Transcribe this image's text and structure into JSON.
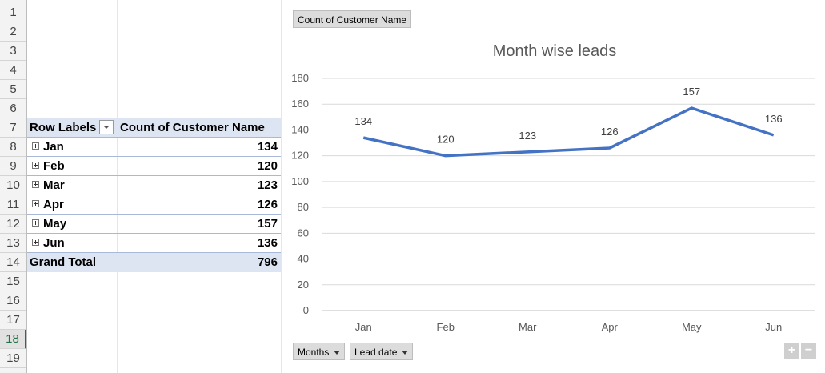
{
  "rows": [
    "1",
    "2",
    "3",
    "4",
    "5",
    "6",
    "7",
    "8",
    "9",
    "10",
    "11",
    "12",
    "13",
    "14",
    "15",
    "16",
    "17",
    "18",
    "19"
  ],
  "pivot": {
    "row_labels_header": "Row Labels",
    "value_header": "Count of Customer Name",
    "items": [
      {
        "label": "Jan",
        "value": "134"
      },
      {
        "label": "Feb",
        "value": "120"
      },
      {
        "label": "Mar",
        "value": "123"
      },
      {
        "label": "Apr",
        "value": "126"
      },
      {
        "label": "May",
        "value": "157"
      },
      {
        "label": "Jun",
        "value": "136"
      }
    ],
    "grand_total_label": "Grand Total",
    "grand_total_value": "796"
  },
  "chart_buttons": {
    "value_field": "Count of Customer Name",
    "axis_field_1": "Months",
    "axis_field_2": "Lead date",
    "zoom_in": "+",
    "zoom_out": "−"
  },
  "colors": {
    "series": "#4472c4",
    "header_fill": "#dde5f3"
  },
  "chart_data": {
    "type": "line",
    "title": "Month wise leads",
    "categories": [
      "Jan",
      "Feb",
      "Mar",
      "Apr",
      "May",
      "Jun"
    ],
    "series": [
      {
        "values": [
          134,
          120,
          123,
          126,
          157,
          136
        ]
      }
    ],
    "ylim": [
      0,
      180
    ],
    "yticks": [
      0,
      20,
      40,
      60,
      80,
      100,
      120,
      140,
      160,
      180
    ],
    "grid": true,
    "data_labels": true
  }
}
